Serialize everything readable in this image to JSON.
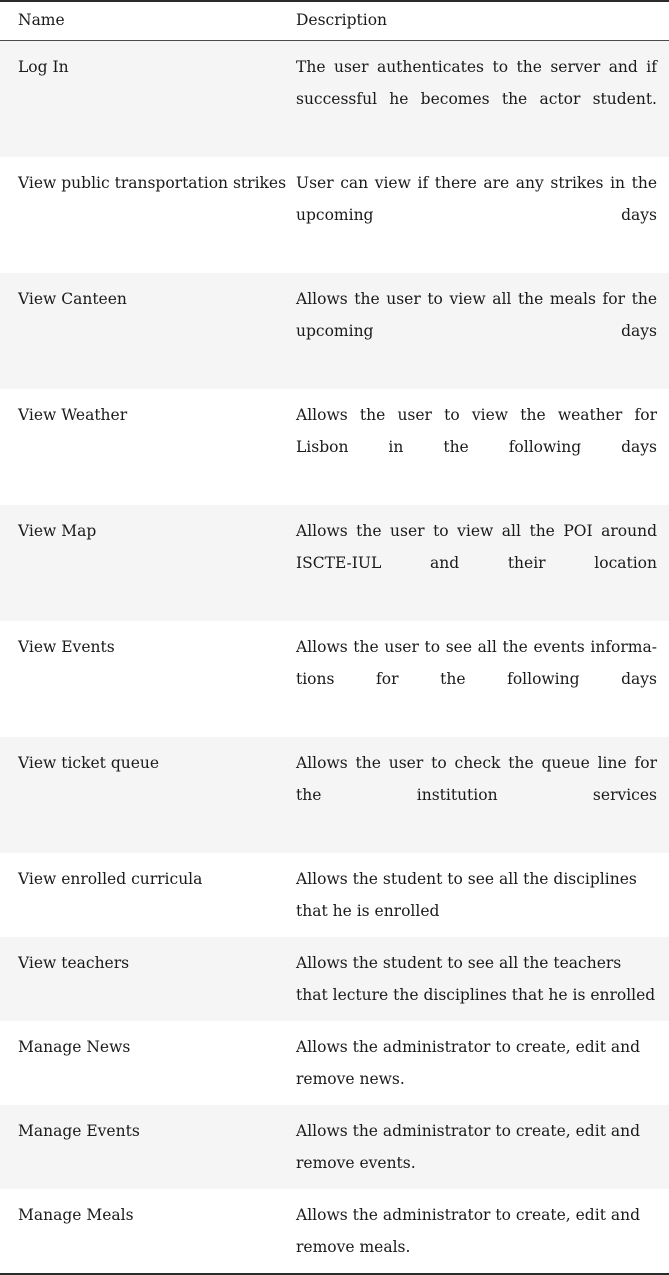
{
  "document": {
    "type": "use-case-table",
    "style": "booktabs-latex",
    "alternating_row_shade_color": "#f5f5f5",
    "page_background": "#ffffff",
    "rule_color": "#2b2b2b"
  },
  "table": {
    "columns": [
      {
        "key": "name",
        "header": "Name"
      },
      {
        "key": "description",
        "header": "Description"
      }
    ],
    "rows": [
      {
        "name": "Log In",
        "description": "The user authenticates to the server and if suc­cessful he becomes the actor student.",
        "shaded": true,
        "justified": true
      },
      {
        "name": "View public transportation strikes",
        "description": "User can view if there are any strikes in the upcoming days",
        "shaded": false,
        "justified": true
      },
      {
        "name": "View Canteen",
        "description": "Allows the user to view all the meals for the upcoming days",
        "shaded": true,
        "justified": true
      },
      {
        "name": "View Weather",
        "description": "Allows the user to view the weather for Lisbon in the following days",
        "shaded": false,
        "justified": true
      },
      {
        "name": "View Map",
        "description": "Allows the user to view all the POI around ISCTE-IUL and their location",
        "shaded": true,
        "justified": true
      },
      {
        "name": "View Events",
        "description": "Allows the user to see all the events informa­tions for the following days",
        "shaded": false,
        "justified": true
      },
      {
        "name": "View ticket queue",
        "description": "Allows the user to check the queue line for the institution services",
        "shaded": true,
        "justified": true
      },
      {
        "name": "View enrolled curricula",
        "description": "Allows the student to see all the disciplines that he is enrolled",
        "shaded": false,
        "justified": false
      },
      {
        "name": "View teachers",
        "description": "Allows the student to see all the teachers that lecture the disciplines that he is enrolled",
        "shaded": true,
        "justified": false
      },
      {
        "name": "Manage News",
        "description": "Allows the administrator to create, edit and re­move news.",
        "shaded": false,
        "justified": false
      },
      {
        "name": "Manage Events",
        "description": "Allows the administrator to create, edit and re­move events.",
        "shaded": true,
        "justified": false
      },
      {
        "name": "Manage Meals",
        "description": "Allows the administrator to create, edit and re­move meals.",
        "shaded": false,
        "justified": false
      }
    ]
  }
}
